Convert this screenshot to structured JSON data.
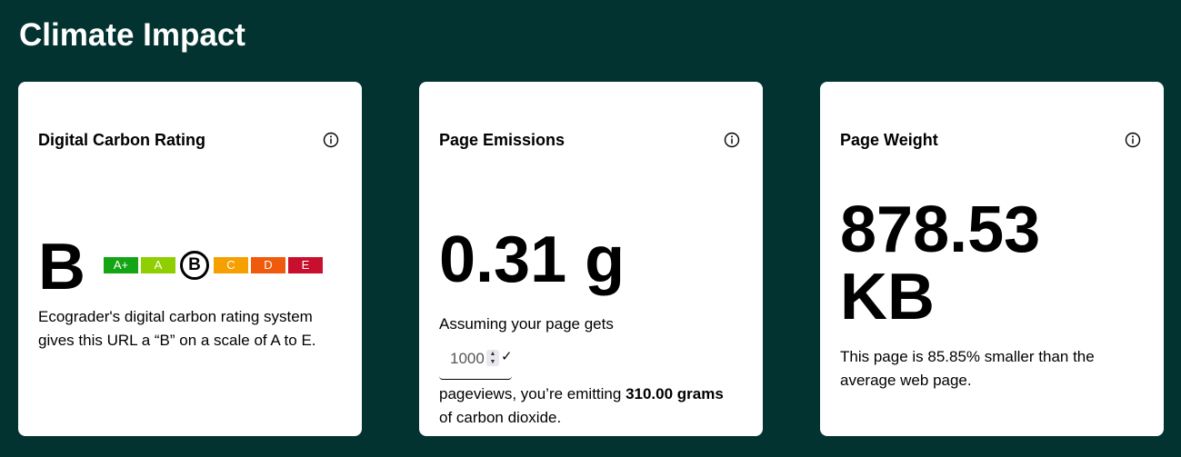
{
  "page": {
    "title": "Climate Impact"
  },
  "cards": {
    "rating": {
      "title": "Digital Carbon Rating",
      "grade": "B",
      "scale": [
        {
          "label": "A+",
          "color": "#14a514"
        },
        {
          "label": "A",
          "color": "#8fce00"
        },
        {
          "label": "B",
          "color": "#ffffff",
          "current": true
        },
        {
          "label": "C",
          "color": "#f5a000"
        },
        {
          "label": "D",
          "color": "#ef5a0c"
        },
        {
          "label": "E",
          "color": "#c8102e"
        }
      ],
      "description": "Ecograder's digital carbon rating system gives this URL a “B” on a scale of A to E."
    },
    "emissions": {
      "title": "Page Emissions",
      "value": "0.31 g",
      "assume_text": "Assuming your page gets",
      "pageviews_value": "1000",
      "emit_prefix": "pageviews, you’re emitting",
      "emit_amount": "310.00 grams",
      "emit_suffix": "of carbon dioxide."
    },
    "weight": {
      "title": "Page Weight",
      "value_line1": "878.53",
      "value_line2": "KB",
      "description": "This page is 85.85% smaller than the average web page."
    }
  }
}
